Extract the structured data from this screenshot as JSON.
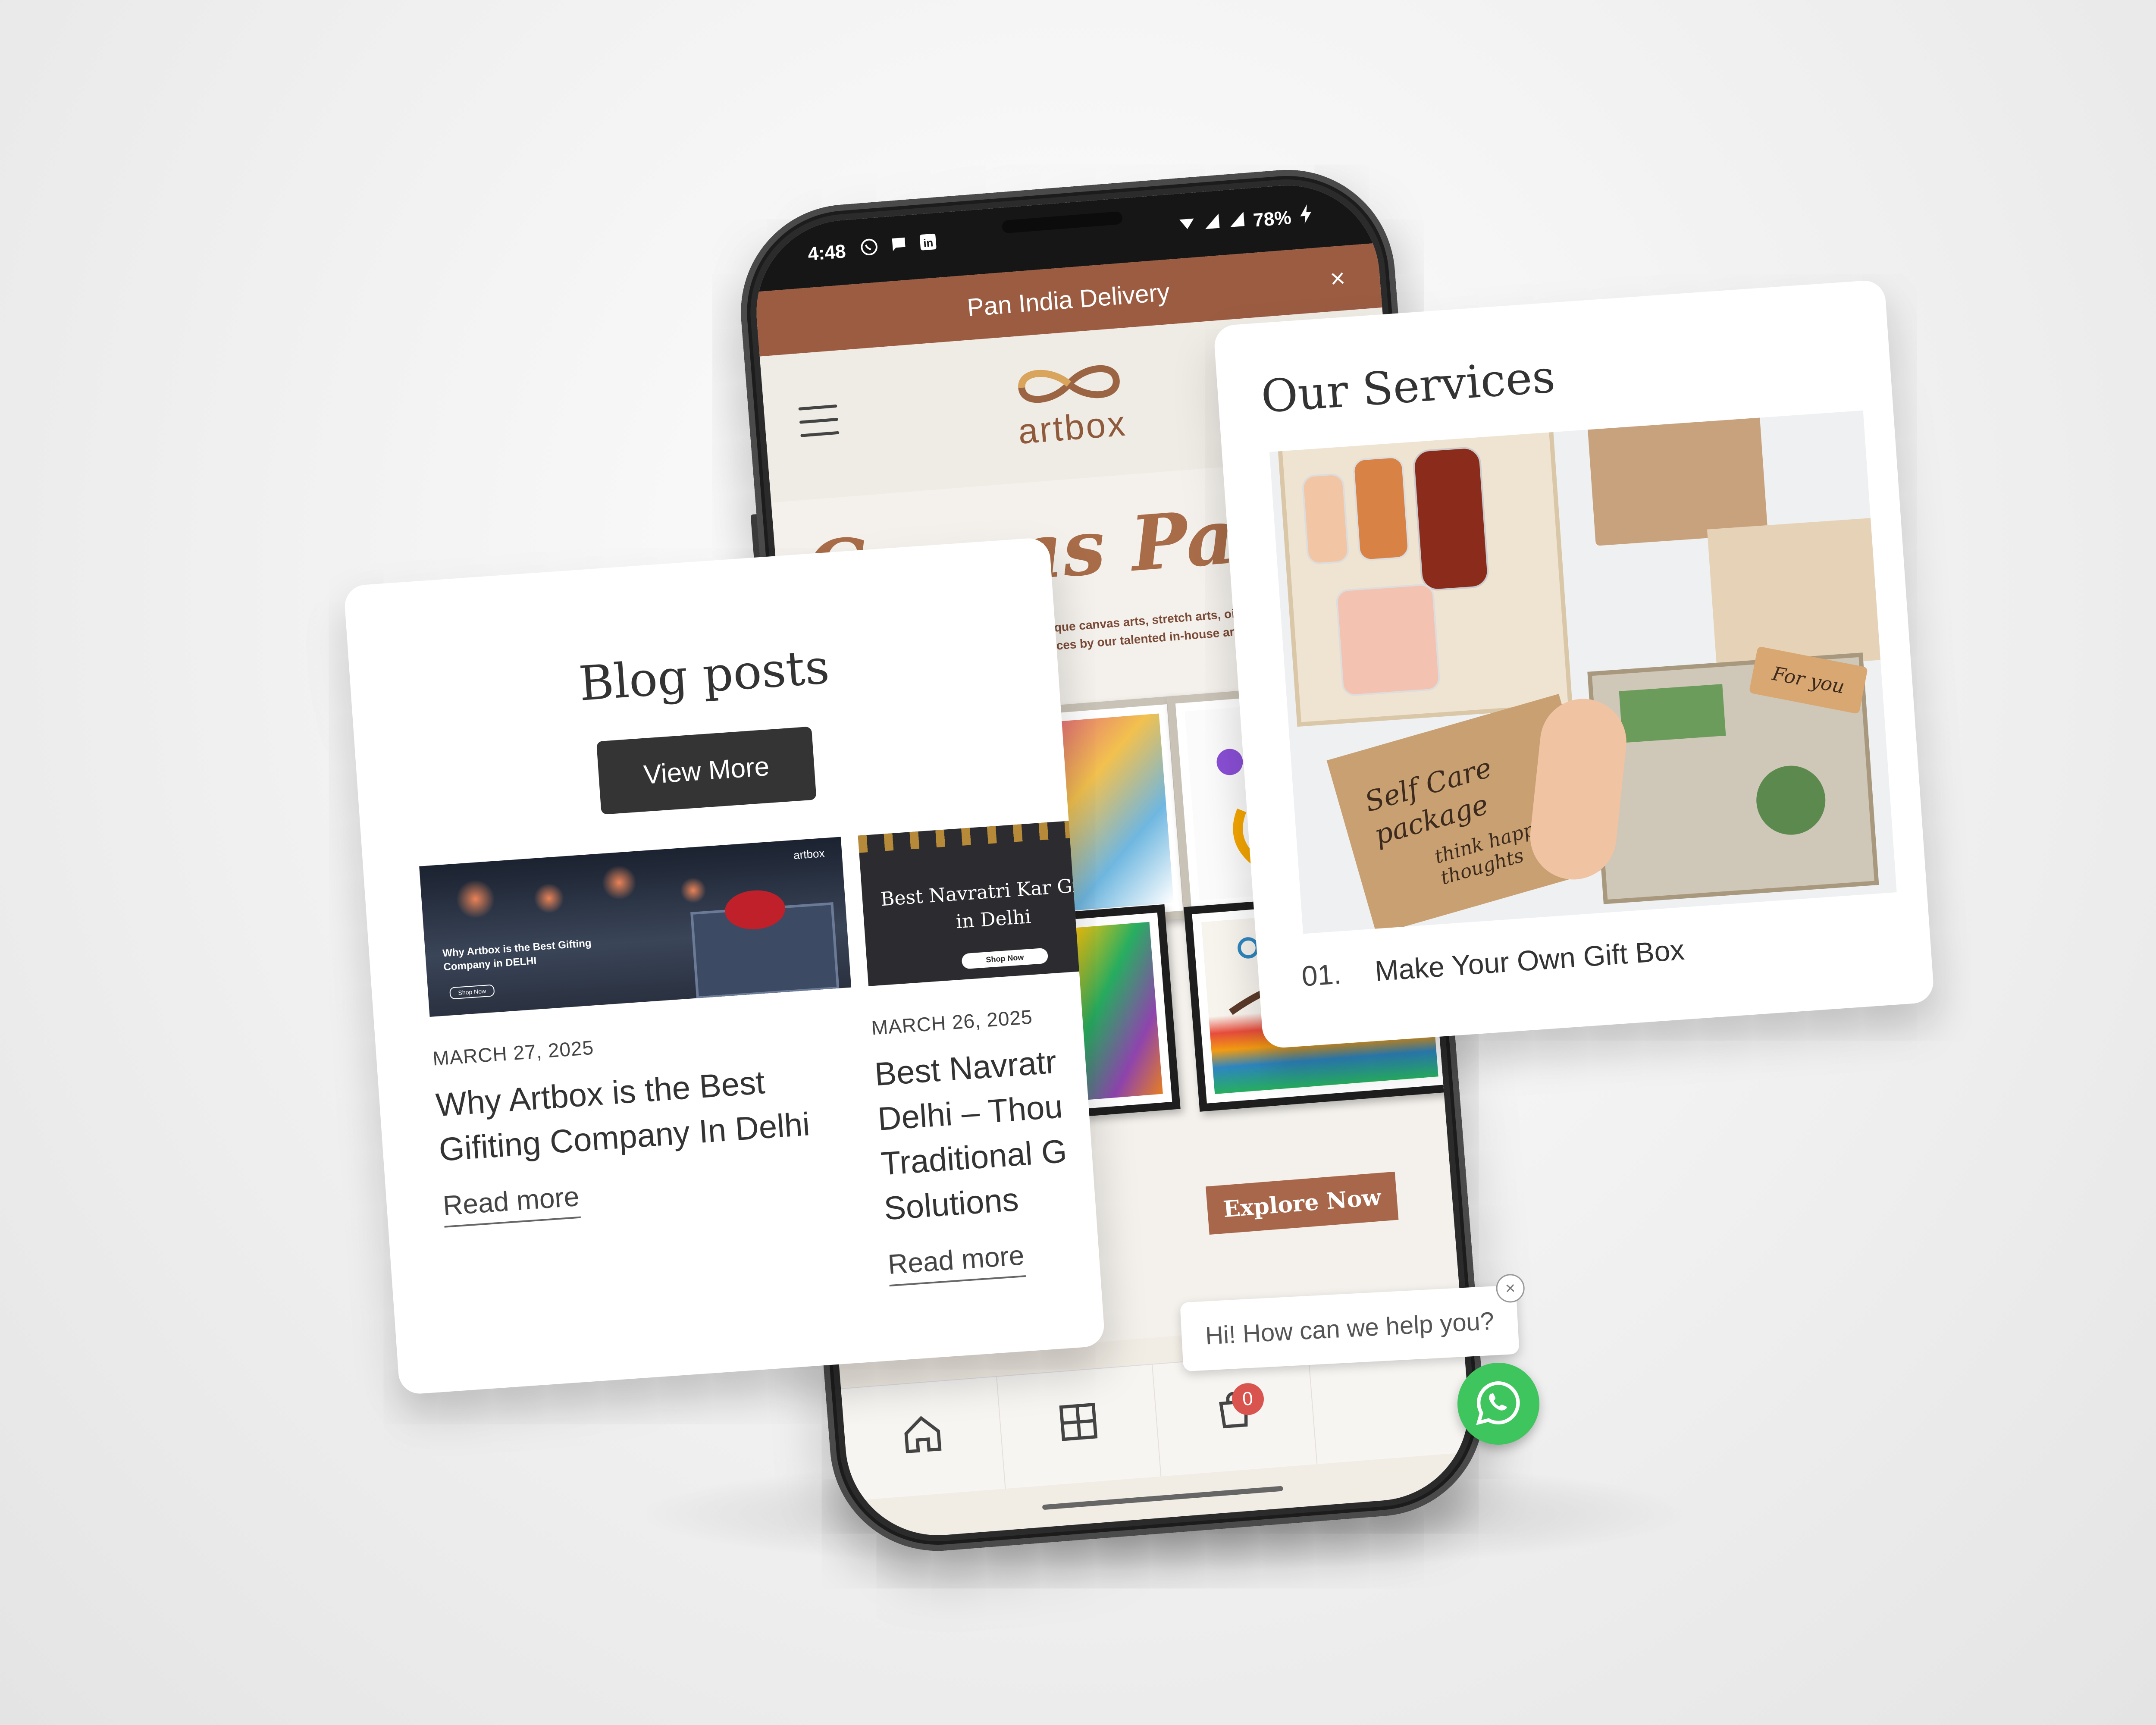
{
  "phone": {
    "status_bar": {
      "time": "4:48",
      "battery": "78%",
      "left_icons": [
        "whatsapp-icon",
        "message-icon",
        "linkedin-icon"
      ],
      "right_icons": [
        "wifi-icon",
        "signal-icon",
        "signal-icon",
        "charging-icon"
      ]
    },
    "promo_bar": {
      "text": "Pan India Delivery",
      "close": "×"
    },
    "header": {
      "logo_text": "artbox",
      "menu_icon": "hamburger-icon",
      "search_icon": "search-icon"
    },
    "hero": {
      "title": "Canvas Paintin",
      "subtitle": "r space with unique canvas arts, stretch arts, oil pa\nmade masterpieces by our talented in-house artis",
      "cta": "Explore Now"
    },
    "bottom_nav": {
      "items": [
        "home-icon",
        "grid-icon",
        "cart-icon"
      ],
      "cart_count": "0"
    }
  },
  "chat": {
    "bubble_text": "Hi! How can we help you?",
    "close": "×",
    "whatsapp_icon": "whatsapp-icon"
  },
  "blog": {
    "title": "Blog posts",
    "view_more": "View More",
    "posts": [
      {
        "date": "MARCH 27, 2025",
        "headline": "Why Artbox is the Best Gifiting Company In Delhi",
        "read_more": "Read more",
        "image_caption": "Why Artbox is the Best Gifting Company in DELHI",
        "image_button": "Shop Now",
        "image_logo": "artbox"
      },
      {
        "date": "MARCH 26, 2025",
        "headline": "Best Navratr Delhi – Thou Traditional G Solutions",
        "read_more": "Read more",
        "image_caption": "Best Navratri Kar Gifts in Delhi",
        "image_button": "Shop Now"
      }
    ]
  },
  "services": {
    "title": "Our Services",
    "image_texts": [
      "Self Care package",
      "think happy thoughts",
      "For you"
    ],
    "items": [
      {
        "number": "01.",
        "label": "Make Your Own Gift Box"
      }
    ]
  },
  "colors": {
    "brand_brown": "#9b5c42",
    "cta_brown": "#a8674a",
    "dark_button": "#343434",
    "whatsapp_green": "#3fc55e",
    "badge_red": "#d9534f"
  }
}
